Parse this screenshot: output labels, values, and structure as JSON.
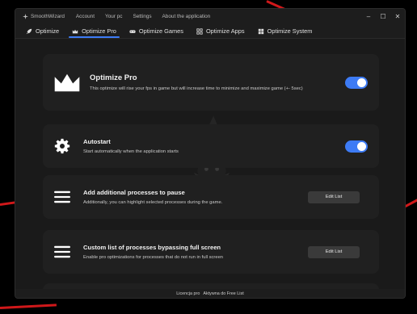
{
  "app": {
    "title": "SmoothWizard",
    "menu": [
      "Account",
      "Your pc",
      "Settings",
      "About the application"
    ]
  },
  "window_controls": {
    "minimize": "–",
    "maximize": "☐",
    "close": "✕"
  },
  "tabs": [
    {
      "label": "Optimize",
      "icon": "rocket-icon"
    },
    {
      "label": "Optimize Pro",
      "icon": "crown-icon",
      "active": true
    },
    {
      "label": "Optimize Games",
      "icon": "gamepad-icon"
    },
    {
      "label": "Optimize Apps",
      "icon": "apps-grid-icon"
    },
    {
      "label": "Optimize System",
      "icon": "windows-icon"
    }
  ],
  "cards": {
    "pro": {
      "title": "Optimize Pro",
      "desc": "This optimize will rise your fps in game but will increase time to minimize and maximize game (+- 5sec)",
      "toggle_on": true
    },
    "autostart": {
      "title": "Autostart",
      "desc": "Start automatically when the application starts",
      "toggle_on": true
    },
    "pause": {
      "title": "Add additional processes to pause",
      "desc": "Additionally, you can highlight selected processes during the game.",
      "button": "Edit List"
    },
    "bypass": {
      "title": "Custom list of processes bypassing full screen",
      "desc": "Enable pro optimizations for processes that do not run in full screen",
      "button": "Edit List"
    }
  },
  "footer": {
    "license_label": "Licencja pro",
    "license_status": "Aktywna do Free List"
  },
  "colors": {
    "accent": "#3d7bf5",
    "background": "#1a1a1a",
    "card": "#202020",
    "button": "#3a3a3a"
  }
}
